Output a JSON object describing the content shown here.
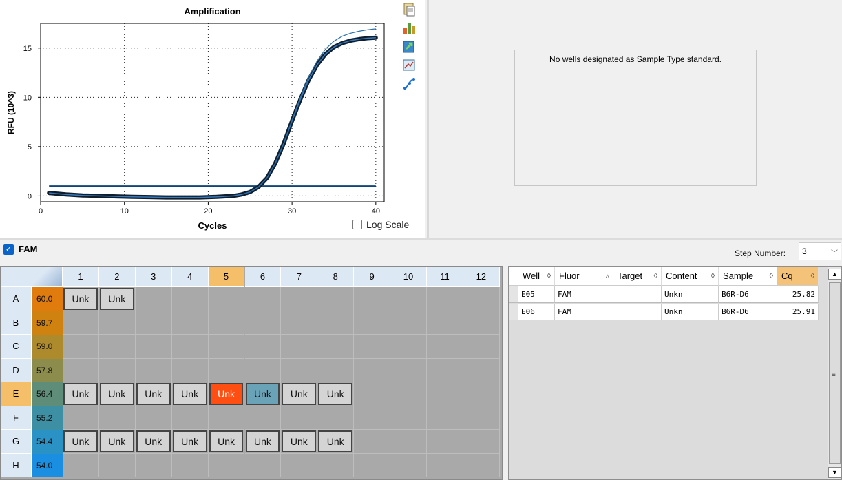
{
  "chart": {
    "icons": [
      "copy-icon",
      "chart-options-icon",
      "export-icon",
      "graph-settings-icon",
      "curve-fit-icon"
    ],
    "log_scale_label": "Log Scale",
    "log_scale_checked": false
  },
  "chart_data": {
    "type": "line",
    "title": "Amplification",
    "xlabel": "Cycles",
    "ylabel": "RFU (10^3)",
    "xlim": [
      0,
      41
    ],
    "ylim": [
      -0.6,
      17.5
    ],
    "xticks": [
      0,
      10,
      20,
      30,
      40
    ],
    "yticks": [
      0,
      5,
      10,
      15
    ],
    "grid": true,
    "threshold": 1.0,
    "series": [
      {
        "color": "#0e1e2e",
        "x": [
          1,
          3,
          5,
          7,
          9,
          11,
          13,
          15,
          17,
          19,
          21,
          23,
          24,
          25,
          26,
          27,
          28,
          29,
          30,
          31,
          32,
          33,
          34,
          35,
          36,
          37,
          38,
          39,
          40
        ],
        "y": [
          0.3,
          0.15,
          0.05,
          0.0,
          -0.05,
          -0.1,
          -0.12,
          -0.15,
          -0.15,
          -0.15,
          -0.1,
          0.0,
          0.15,
          0.4,
          0.9,
          1.8,
          3.3,
          5.3,
          7.6,
          9.8,
          11.8,
          13.3,
          14.4,
          15.1,
          15.5,
          15.75,
          15.9,
          16.0,
          16.05
        ]
      },
      {
        "color": "#2a6fa8",
        "x": [
          24,
          25,
          26,
          27,
          28,
          29,
          30,
          31,
          32,
          33,
          34,
          35,
          36,
          37,
          38,
          39,
          40
        ],
        "y": [
          0.15,
          0.4,
          0.9,
          1.8,
          3.3,
          5.3,
          7.7,
          10.0,
          12.1,
          13.7,
          14.9,
          15.7,
          16.2,
          16.5,
          16.7,
          16.85,
          16.95
        ]
      }
    ]
  },
  "standard_curve": {
    "message": "No wells designated as Sample Type standard."
  },
  "fluor_bar": {
    "fluor_label": "FAM",
    "fluor_checked": true,
    "step_label": "Step Number:",
    "step_value": "3"
  },
  "plate": {
    "columns": [
      "1",
      "2",
      "3",
      "4",
      "5",
      "6",
      "7",
      "8",
      "9",
      "10",
      "11",
      "12"
    ],
    "rows": [
      {
        "label": "A",
        "temp": "60.0",
        "temp_color": "#e07b0e",
        "wells": [
          "Unk",
          "Unk",
          "",
          "",
          "",
          "",
          "",
          "",
          "",
          "",
          "",
          ""
        ]
      },
      {
        "label": "B",
        "temp": "59.7",
        "temp_color": "#cf820f",
        "wells": [
          "",
          "",
          "",
          "",
          "",
          "",
          "",
          "",
          "",
          "",
          "",
          ""
        ]
      },
      {
        "label": "C",
        "temp": "59.0",
        "temp_color": "#ad8a2c",
        "wells": [
          "",
          "",
          "",
          "",
          "",
          "",
          "",
          "",
          "",
          "",
          "",
          ""
        ]
      },
      {
        "label": "D",
        "temp": "57.8",
        "temp_color": "#8c8c4c",
        "wells": [
          "",
          "",
          "",
          "",
          "",
          "",
          "",
          "",
          "",
          "",
          "",
          ""
        ]
      },
      {
        "label": "E",
        "temp": "56.4",
        "temp_color": "#5e8e7a",
        "wells": [
          "Unk",
          "Unk",
          "Unk",
          "Unk",
          "Unk",
          "Unk",
          "Unk",
          "Unk",
          "",
          "",
          "",
          ""
        ]
      },
      {
        "label": "F",
        "temp": "55.2",
        "temp_color": "#3d8fa3",
        "wells": [
          "",
          "",
          "",
          "",
          "",
          "",
          "",
          "",
          "",
          "",
          "",
          ""
        ]
      },
      {
        "label": "G",
        "temp": "54.4",
        "temp_color": "#2a92c4",
        "wells": [
          "Unk",
          "Unk",
          "Unk",
          "Unk",
          "Unk",
          "Unk",
          "Unk",
          "Unk",
          "",
          "",
          "",
          ""
        ]
      },
      {
        "label": "H",
        "temp": "54.0",
        "temp_color": "#1a8ee0",
        "wells": [
          "",
          "",
          "",
          "",
          "",
          "",
          "",
          "",
          "",
          "",
          "",
          ""
        ]
      }
    ],
    "selected_row": "E",
    "selected_column": "5",
    "highlight_well_red": "E5",
    "highlight_well_teal": "E6"
  },
  "table": {
    "headers": [
      "Well",
      "Fluor",
      "Target",
      "Content",
      "Sample",
      "Cq"
    ],
    "sort_icons": [
      "◊",
      "▵",
      "◊",
      "◊",
      "◊",
      "◊"
    ],
    "rows": [
      [
        "E05",
        "FAM",
        "",
        "Unkn",
        "B6R-D6",
        "25.82"
      ],
      [
        "E06",
        "FAM",
        "",
        "Unkn",
        "B6R-D6",
        "25.91"
      ]
    ]
  }
}
